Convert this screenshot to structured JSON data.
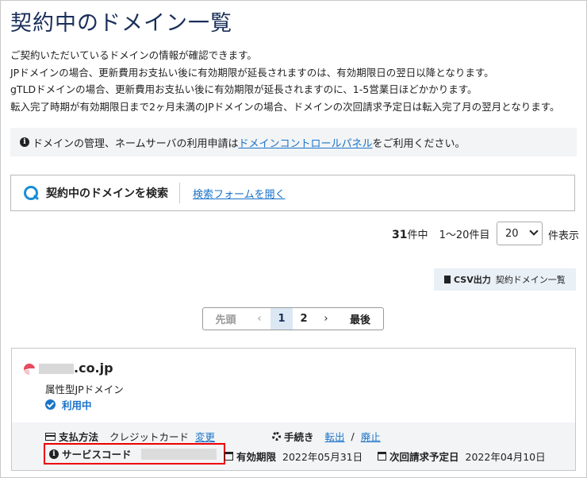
{
  "page": {
    "title": "契約中のドメイン一覧",
    "desc": [
      "ご契約いただいているドメインの情報が確認できます。",
      "JPドメインの場合、更新費用お支払い後に有効期限が延長されますのは、有効期限日の翌日以降となります。",
      "gTLDドメインの場合、更新費用お支払い後に有効期限が延長されますのに、1-5営業日ほどかかります。",
      "転入完了時期が有効期限日まで2ヶ月未満のJPドメインの場合、ドメインの次回請求予定日は転入完了月の翌月となります。"
    ]
  },
  "notice": {
    "before": "ドメインの管理、ネームサーバの利用申請は",
    "link": "ドメインコントロールパネル",
    "after": "をご利用ください。"
  },
  "search": {
    "label": "契約中のドメインを検索",
    "open_link": "検索フォームを開く"
  },
  "results": {
    "total": "31",
    "total_suffix": "件中",
    "range": "1〜20件目",
    "per_page": "20",
    "per_page_suffix": "件表示"
  },
  "csv": {
    "label": "CSV出力",
    "sub": "契約ドメイン一覧"
  },
  "pagination": {
    "first": "先頭",
    "prev": "‹",
    "pages": [
      "1",
      "2"
    ],
    "next": "›",
    "last": "最後"
  },
  "domain_card": {
    "domain_suffix": ".co.jp",
    "type": "属性型JPドメイン",
    "status": "利用中",
    "payment_label": "支払方法",
    "payment_value": "クレジットカード",
    "payment_change": "変更",
    "procedure_label": "手続き",
    "transfer_link": "転出",
    "slash": "/",
    "cancel_link": "廃止",
    "service_code_label": "サービスコード",
    "expiry_label": "有効期限",
    "expiry_value": "2022年05月31日",
    "next_bill_label": "次回請求予定日",
    "next_bill_value": "2022年04月10日"
  },
  "colors": {
    "accent": "#1a73c8",
    "title": "#1a2f5a",
    "highlight_border": "#e00000"
  }
}
